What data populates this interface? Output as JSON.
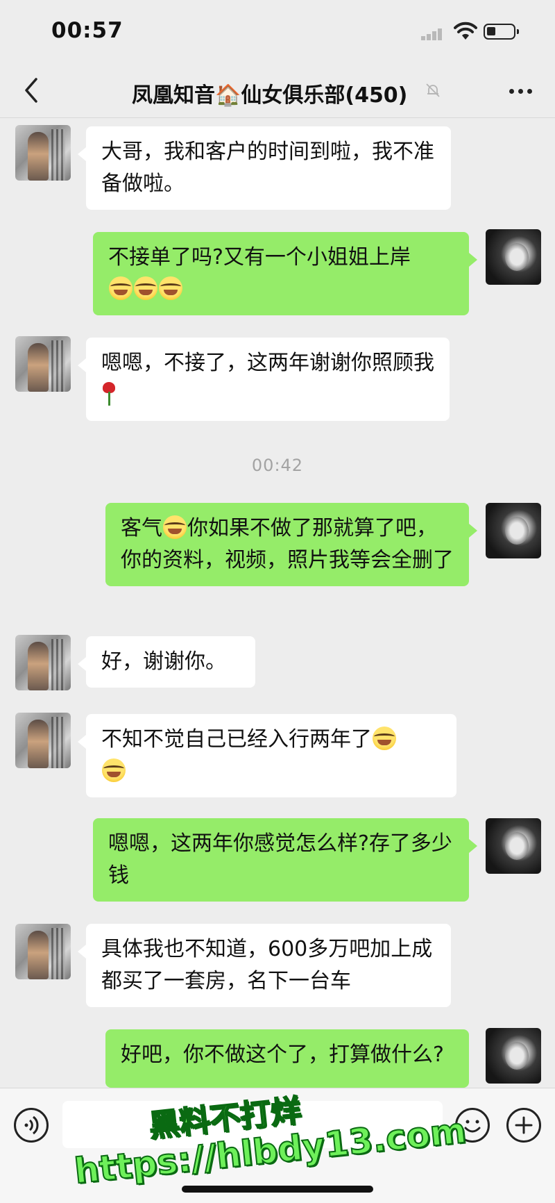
{
  "status_bar": {
    "time": "00:57"
  },
  "nav": {
    "title": "凤凰知音🏠仙女俱乐部(450)",
    "back_icon": "chevron-left-icon",
    "mute_icon": "bell-mute-icon",
    "more_icon": "ellipsis-icon"
  },
  "messages": [
    {
      "side": "left",
      "text": "大哥，我和客户的时间到啦，我不准备做啦。"
    },
    {
      "side": "right",
      "text": "不接单了吗?又有一个小姐姐上岸",
      "emojis": [
        "laugh-cry-emoji",
        "laugh-cry-emoji",
        "laugh-cry-emoji"
      ]
    },
    {
      "side": "left",
      "text": "嗯嗯，不接了，这两年谢谢你照顾我",
      "trailing_icon": "rose-emoji"
    },
    {
      "side": "right",
      "text_a": "客气",
      "text_b": "你如果不做了那就算了吧，你的资料，视频，照片我等会全删了",
      "inline_emoji": "laugh-cry-emoji"
    },
    {
      "side": "left",
      "text": "好，谢谢你。"
    },
    {
      "side": "left",
      "text": "不知不觉自己已经入行两年了",
      "emojis": [
        "laugh-cry-emoji",
        "laugh-cry-emoji"
      ]
    },
    {
      "side": "right",
      "text": "嗯嗯，这两年你感觉怎么样?存了多少钱"
    },
    {
      "side": "left",
      "text": "具体我也不知道，600多万吧加上成都买了一套房，名下一台车"
    },
    {
      "side": "right",
      "text": "好吧，你不做这个了，打算做什么?"
    }
  ],
  "timestamp": "00:42",
  "input_bar": {
    "voice_icon": "voice-icon",
    "emoji_icon": "smiley-icon",
    "plus_icon": "plus-icon"
  },
  "watermark": {
    "line1": "黑料不打烊",
    "line2": "https://hlbdy13.com"
  },
  "colors": {
    "background": "#ededed",
    "green_bubble": "#95ec69",
    "white_bubble": "#ffffff",
    "watermark": "#6ef05a"
  }
}
